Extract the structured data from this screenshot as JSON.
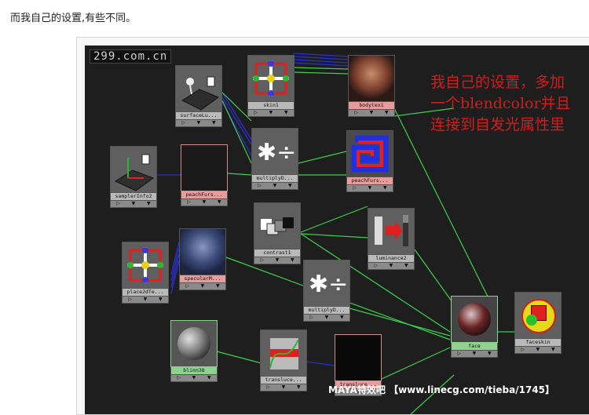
{
  "caption": "而我自己的设置,有些不同。",
  "watermark": "299.com.cn",
  "note": "我自己的设置，多加\n一个blendcolor并且\n连接到自发光属性里",
  "credit": "MAYA特效吧 【www.linecg.com/tieba/1745】",
  "nodes": {
    "skin1": "skin1",
    "bodytex1": "bodytex1",
    "surfacelu": "surfaceLu...",
    "samplerinfo2": "samplerInfo2",
    "peachfurs1": "peachFurs...",
    "multiply1": "multiplyD...",
    "peachfurs2": "peachFurs...",
    "contrast1": "contrast1",
    "luminance2": "luminance2",
    "place2dtex": "place2dTe...",
    "specular": "specularM...",
    "multiply2": "multiplyD...",
    "blinn": "blinn38",
    "translucence1": "transluce...",
    "translucence2": "transluce...",
    "face": "face",
    "faceskin": "faceskin"
  },
  "controls": {
    "port": "▷",
    "arrow": "▼"
  },
  "colors": {
    "wire_green": "#3ecf4a",
    "wire_blue": "#2a2fd0",
    "note_red": "#d11d1d"
  }
}
